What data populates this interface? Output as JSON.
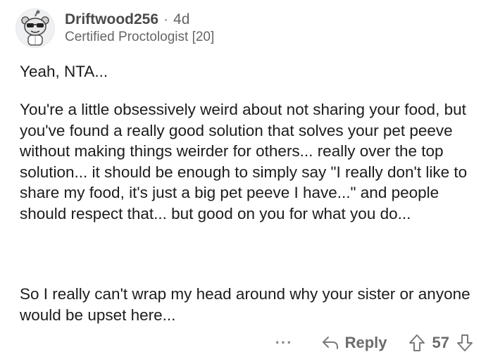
{
  "comment": {
    "username": "Driftwood256",
    "separator": "·",
    "age": "4d",
    "flair": "Certified Proctologist [20]",
    "paragraphs": [
      "Yeah, NTA...",
      "You're a little obsessively weird about not sharing your food, but you've found a really good solution that solves your pet peeve without making things weirder for others... really over the top solution... it should be enough to simply say \"I really don't like to share my food, it's just a big pet peeve I have...\" and people should respect that... but good on you for what you do...",
      "So I really can't wrap my head around why your sister or anyone would be upset here..."
    ]
  },
  "actions": {
    "more_label": "···",
    "reply_label": "Reply",
    "score": "57"
  },
  "icons": {
    "avatar": "snoo-avatar-icon",
    "reply": "reply-arrow-icon",
    "upvote": "upvote-arrow-icon",
    "downvote": "downvote-arrow-icon"
  }
}
